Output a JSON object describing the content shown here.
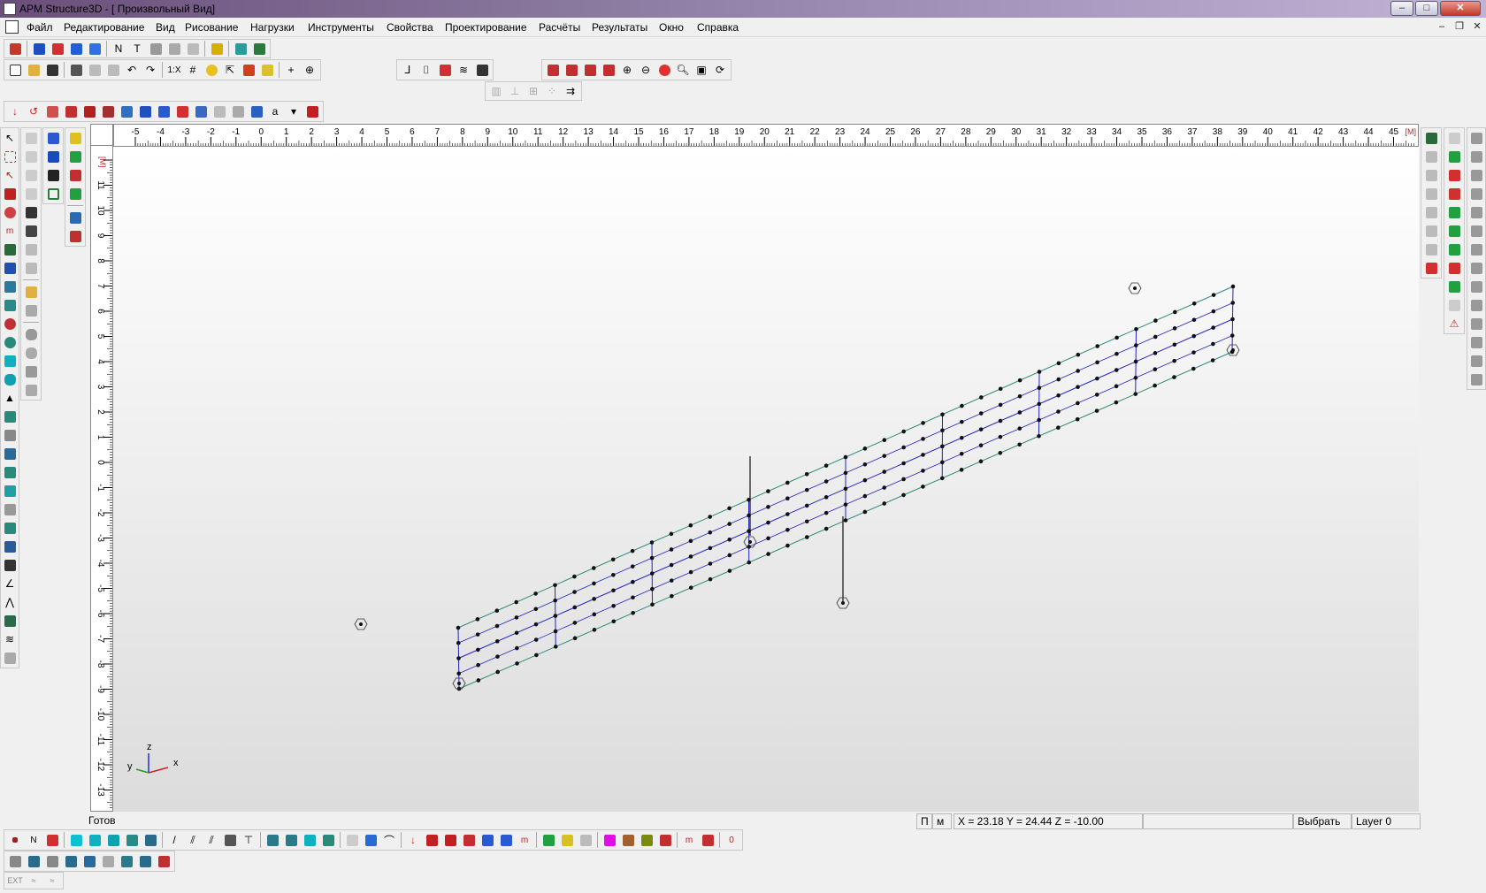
{
  "window": {
    "title": "APM Structure3D - [ Произвольный Вид]",
    "minimize": "–",
    "maximize": "□",
    "close": "✕"
  },
  "menu": {
    "items": [
      "Файл",
      "Редактирование",
      "Вид",
      "Рисование",
      "Нагрузки",
      "Инструменты",
      "Свойства",
      "Проектирование",
      "Расчёты",
      "Результаты",
      "Окно",
      "Справка"
    ]
  },
  "toolbar": {
    "scale_label": "1:X",
    "dropdown_arrow": "▾"
  },
  "ruler": {
    "unit_top": "[M]",
    "unit_left": "[M]",
    "top_ticks": [
      "-5",
      "-4",
      "-3",
      "-2",
      "-1",
      "0",
      "1",
      "2",
      "3",
      "4",
      "5",
      "6",
      "7",
      "8",
      "9",
      "10",
      "11",
      "12",
      "13",
      "14",
      "15",
      "16",
      "17",
      "18",
      "19",
      "20",
      "21",
      "22",
      "23",
      "24",
      "25",
      "26",
      "27",
      "28",
      "29",
      "30",
      "31",
      "32",
      "33",
      "34",
      "35",
      "36",
      "37",
      "38",
      "39",
      "40",
      "41",
      "42",
      "43",
      "44",
      "45"
    ],
    "left_ticks": [
      "12",
      "11",
      "10",
      "9",
      "8",
      "7",
      "6",
      "5",
      "4",
      "3",
      "2",
      "1",
      "0",
      "-1",
      "-2",
      "-3",
      "-4",
      "-5",
      "-6",
      "-7",
      "-8",
      "-9",
      "-10",
      "-11",
      "-12",
      "-13"
    ]
  },
  "axes": {
    "x": "x",
    "y": "y",
    "z": "z"
  },
  "status": {
    "ready": "Готов",
    "p_label": "П",
    "m_label": "м",
    "coords": "X = 23.18 Y = 24.44 Z = -10.00",
    "mode": "Выбрать",
    "layer": "Layer 0"
  },
  "colors": {
    "grid_blue": "#2020c8",
    "edge_teal": "#2e8b7a",
    "node": "#111111",
    "title_start": "#6a4f7a"
  }
}
